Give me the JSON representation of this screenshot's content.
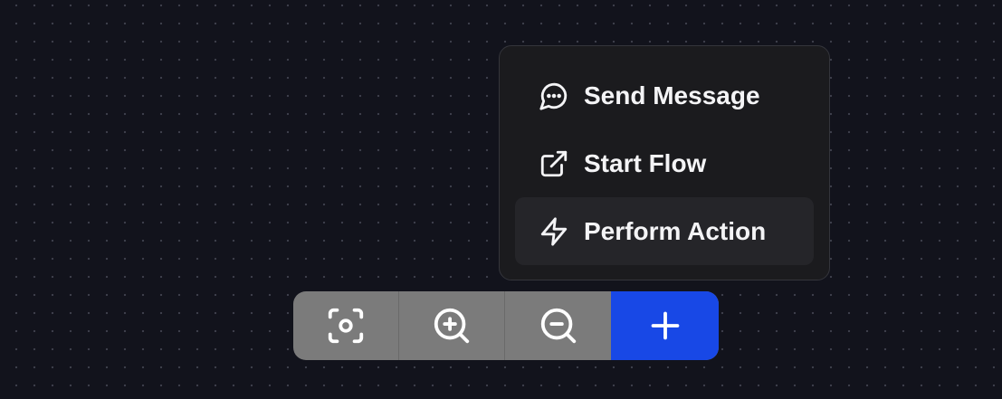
{
  "menu": {
    "items": [
      {
        "label": "Send Message",
        "icon": "message-circle-icon"
      },
      {
        "label": "Start Flow",
        "icon": "external-link-icon"
      },
      {
        "label": "Perform Action",
        "icon": "zap-icon",
        "highlighted": true
      }
    ]
  },
  "toolbar": {
    "buttons": [
      {
        "icon": "fit-view-icon"
      },
      {
        "icon": "zoom-in-icon"
      },
      {
        "icon": "zoom-out-icon"
      },
      {
        "icon": "plus-icon"
      }
    ],
    "accent_color": "#1848e6"
  },
  "colors": {
    "background": "#12131c",
    "menu_background": "#1b1b1e",
    "menu_hover": "#252529",
    "toolbar_background": "#7b7b7b"
  }
}
